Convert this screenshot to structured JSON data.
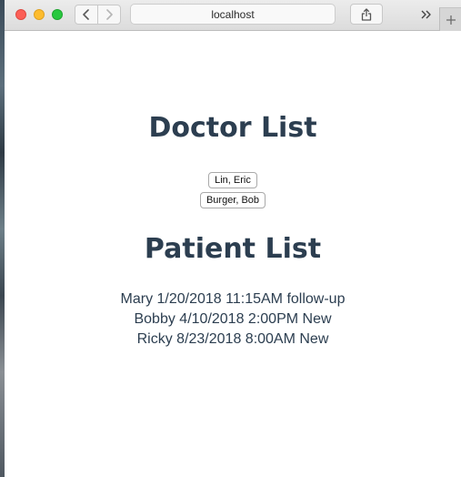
{
  "browser": {
    "url": "localhost"
  },
  "page": {
    "doctor_heading": "Doctor List",
    "doctors": [
      {
        "name": "Lin, Eric"
      },
      {
        "name": "Burger, Bob"
      }
    ],
    "patient_heading": "Patient List",
    "patients": [
      {
        "text": "Mary 1/20/2018 11:15AM follow-up"
      },
      {
        "text": "Bobby 4/10/2018 2:00PM New"
      },
      {
        "text": "Ricky 8/23/2018 8:00AM New"
      }
    ]
  },
  "icons": {
    "close": "traffic-light-red",
    "minimize": "traffic-light-yellow",
    "zoom": "traffic-light-green",
    "back": "chevron-left",
    "forward": "chevron-right",
    "share": "share-box-arrow",
    "overflow": "double-chevron-right",
    "new_tab": "plus"
  }
}
